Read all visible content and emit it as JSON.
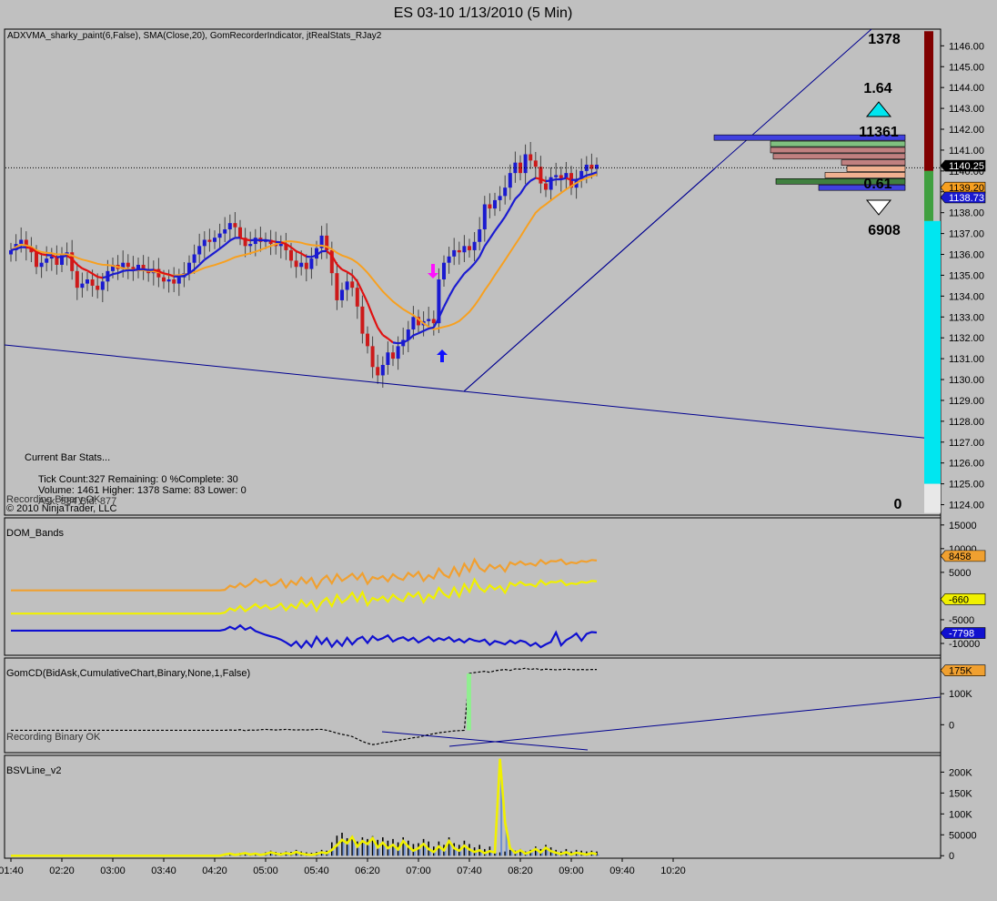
{
  "window": {
    "title": "ES 03-10  1/13/2010 (5 Min)"
  },
  "colors": {
    "background": "#c0c0c0",
    "up_bar": "#1a1ad0",
    "down_bar": "#cc1a1a",
    "neutral_bar": "#6f6f6f",
    "adxvma": "#e01010",
    "sma": "#f7a020",
    "dom_upper": "#f0a030",
    "dom_mid": "#f0f000",
    "dom_lower": "#1010d0",
    "cumdelta": "#000000",
    "bsv_line": "#f0f000",
    "bsv_hist": "#000000",
    "trendline": "#000090",
    "cyan_bar": "#00e6f0",
    "maroon_bar": "#800000",
    "green_bar": "#40a040"
  },
  "chart_data": [
    {
      "type": "candlestick",
      "panel": "price",
      "label": "ADXVMA_sharky_paint(6,False), SMA(Close,20), GomRecorderIndicator, jtRealStats_RJay2",
      "yticks": [
        1146,
        1145,
        1144,
        1143,
        1142,
        1141,
        1140,
        1139,
        1138,
        1137,
        1136,
        1135,
        1134,
        1133,
        1132,
        1131,
        1130,
        1129,
        1128,
        1127,
        1126,
        1125,
        1124
      ],
      "ytick_labels": [
        "1146.00",
        "1145.00",
        "1144.00",
        "1143.00",
        "1142.00",
        "1141.00",
        "1140.00",
        "1139.00",
        "1138.00",
        "1137.00",
        "1136.00",
        "1135.00",
        "1134.00",
        "1133.00",
        "1132.00",
        "1131.00",
        "1130.00",
        "1129.00",
        "1128.00",
        "1127.00",
        "1126.00",
        "1125.00",
        "1124.00"
      ],
      "ylim": [
        1123.5,
        1146.8
      ],
      "xtick_labels": [
        "01:40",
        "02:20",
        "03:00",
        "03:40",
        "04:20",
        "05:00",
        "05:40",
        "06:20",
        "07:00",
        "07:40",
        "08:20",
        "09:00",
        "09:40",
        "10:20"
      ],
      "closes": [
        1136.2,
        1136.5,
        1136.7,
        1136.3,
        1136.1,
        1135.4,
        1135.6,
        1135.8,
        1135.9,
        1135.5,
        1136.0,
        1136.1,
        1135.2,
        1134.4,
        1134.6,
        1134.8,
        1134.5,
        1134.3,
        1134.7,
        1135.2,
        1135.5,
        1135.3,
        1135.6,
        1135.4,
        1135.2,
        1135.5,
        1135.3,
        1135.1,
        1135.3,
        1134.9,
        1134.7,
        1134.8,
        1134.6,
        1134.9,
        1135.1,
        1135.6,
        1136.0,
        1136.4,
        1136.7,
        1136.6,
        1136.8,
        1137.0,
        1137.2,
        1137.5,
        1137.3,
        1136.8,
        1136.4,
        1136.5,
        1136.8,
        1136.6,
        1136.7,
        1136.5,
        1136.4,
        1136.5,
        1136.2,
        1135.7,
        1135.4,
        1135.6,
        1135.3,
        1135.8,
        1136.3,
        1136.9,
        1136.2,
        1135.1,
        1133.8,
        1134.3,
        1134.7,
        1134.4,
        1133.5,
        1132.2,
        1131.6,
        1130.6,
        1130.2,
        1130.7,
        1131.3,
        1131.0,
        1131.6,
        1131.9,
        1132.4,
        1133.0,
        1132.6,
        1132.8,
        1132.9,
        1132.7,
        1134.8,
        1135.6,
        1135.9,
        1136.2,
        1136.1,
        1136.4,
        1136.2,
        1136.6,
        1137.2,
        1138.4,
        1138.2,
        1138.6,
        1138.8,
        1139.2,
        1139.9,
        1140.4,
        1139.9,
        1140.8,
        1140.5,
        1140.2,
        1139.4,
        1139.1,
        1139.7,
        1139.8,
        1139.6,
        1139.9,
        1139.2,
        1139.6,
        1140.0,
        1140.3,
        1140.1,
        1140.3
      ],
      "adxvma_last": 1138.73,
      "sma_last": 1139.2,
      "last_price_label": "1140.25",
      "sma_label": "1139.20",
      "adxvma_label": "1138.73",
      "bar_colors": "up/down/neutral",
      "volume_profile": [
        {
          "price": 1141.6,
          "width": 210,
          "color": "#4040e0"
        },
        {
          "price": 1141.3,
          "width": 148,
          "color": "#80c080"
        },
        {
          "price": 1141.0,
          "width": 148,
          "color": "#c08080"
        },
        {
          "price": 1140.7,
          "width": 145,
          "color": "#c08080"
        },
        {
          "price": 1140.4,
          "width": 70,
          "color": "#c08080"
        },
        {
          "price": 1140.1,
          "width": 64,
          "color": "#f0b090"
        },
        {
          "price": 1139.8,
          "width": 88,
          "color": "#f0b090"
        },
        {
          "price": 1139.5,
          "width": 142,
          "color": "#408040"
        },
        {
          "price": 1139.2,
          "width": 95,
          "color": "#4040e0"
        }
      ],
      "stats": {
        "top": "1378",
        "ratio_up": "1.64",
        "ask_volume": "11361",
        "ratio_down": "0.61",
        "bid_volume": "6908",
        "bottom": "0"
      },
      "annotations": {
        "current_bar_title": "Current Bar Stats...",
        "line1": "Tick Count:327  Remaining: 0  %Complete: 30",
        "line2": "Volume: 1461   Higher: 1378   Same: 83   Lower: 0",
        "line3": "Ask: 584  Bid: 877",
        "recording": "Recording Binary OK",
        "copyright": "© 2010 NinjaTrader, LLC"
      }
    },
    {
      "type": "line",
      "panel": "dom",
      "label": "DOM_Bands",
      "yticks": [
        15000,
        10000,
        5000,
        -5000,
        -10000
      ],
      "ytick_labels": [
        "15000",
        "10000",
        "5000",
        "-5000",
        "-10000"
      ],
      "ylim": [
        -12500,
        16500
      ],
      "series": [
        {
          "values": [
            1200,
            1200,
            1200,
            1200,
            1200,
            1200,
            1200,
            1200,
            1200,
            1200,
            1200,
            1200,
            1200,
            1200,
            1200,
            1200,
            1200,
            1200,
            1200,
            1200,
            1200,
            1200,
            1200,
            1200,
            1200,
            1200,
            1200,
            1200,
            1200,
            1200,
            1200,
            1200,
            1200,
            1200,
            1200,
            1200,
            1200,
            1200,
            1200,
            1200,
            1200,
            1200,
            1300,
            2200,
            1800,
            2700,
            1900,
            2600,
            3600,
            2800,
            3300,
            2200,
            2600,
            3500,
            1800,
            3200,
            2400,
            3900,
            2700,
            3800,
            1700,
            3400,
            4300,
            2700,
            4600,
            3200,
            3900,
            4700,
            3500,
            4800,
            2600,
            4000,
            3600,
            4200,
            3100,
            4600,
            3800,
            3400,
            4900,
            4100,
            5100,
            3200,
            4400,
            3700,
            5800,
            4500,
            3900,
            6100,
            4300,
            6800,
            5200,
            7700,
            5900,
            5200,
            6600,
            5800,
            6500,
            5200,
            7100,
            6600,
            7300,
            6600,
            6900,
            6400,
            7600,
            6800,
            7400,
            7300,
            7700,
            6700,
            7100,
            6900,
            7400,
            7200,
            7600,
            7500
          ]
        },
        {
          "values": [
            -3700,
            -3700,
            -3700,
            -3700,
            -3700,
            -3700,
            -3700,
            -3700,
            -3700,
            -3700,
            -3700,
            -3700,
            -3700,
            -3700,
            -3700,
            -3700,
            -3700,
            -3700,
            -3700,
            -3700,
            -3700,
            -3700,
            -3700,
            -3700,
            -3700,
            -3700,
            -3700,
            -3700,
            -3700,
            -3700,
            -3700,
            -3700,
            -3700,
            -3700,
            -3700,
            -3700,
            -3700,
            -3700,
            -3700,
            -3700,
            -3700,
            -3700,
            -3500,
            -2600,
            -3100,
            -2100,
            -3200,
            -2500,
            -1700,
            -2600,
            -1900,
            -2800,
            -2400,
            -1600,
            -3000,
            -1800,
            -2600,
            -900,
            -2200,
            -1100,
            -3100,
            -1300,
            -400,
            -2100,
            200,
            -1400,
            -600,
            700,
            -1100,
            800,
            -1900,
            -400,
            -900,
            -100,
            -1200,
            300,
            -600,
            -1100,
            600,
            -200,
            800,
            -1300,
            300,
            -500,
            1700,
            400,
            -300,
            1800,
            -100,
            2500,
            900,
            3500,
            1700,
            900,
            2300,
            1400,
            2100,
            700,
            2800,
            2200,
            3000,
            2300,
            2500,
            2000,
            3300,
            2400,
            3000,
            2900,
            3300,
            2300,
            2700,
            2500,
            3000,
            2800,
            3200,
            3100
          ]
        },
        {
          "values": [
            -7300,
            -7300,
            -7300,
            -7300,
            -7300,
            -7300,
            -7300,
            -7300,
            -7300,
            -7300,
            -7300,
            -7300,
            -7300,
            -7300,
            -7300,
            -7300,
            -7300,
            -7300,
            -7300,
            -7300,
            -7300,
            -7300,
            -7300,
            -7300,
            -7300,
            -7300,
            -7300,
            -7300,
            -7300,
            -7300,
            -7300,
            -7300,
            -7300,
            -7300,
            -7300,
            -7300,
            -7300,
            -7300,
            -7300,
            -7300,
            -7300,
            -7300,
            -7100,
            -6500,
            -7000,
            -6200,
            -7100,
            -6600,
            -7400,
            -7800,
            -8200,
            -8500,
            -8800,
            -9200,
            -9800,
            -10500,
            -9600,
            -10900,
            -9500,
            -10700,
            -8600,
            -10100,
            -8900,
            -10700,
            -9400,
            -10500,
            -8800,
            -10200,
            -9100,
            -8600,
            -9900,
            -8500,
            -9300,
            -8900,
            -8300,
            -9600,
            -9000,
            -8700,
            -9400,
            -8800,
            -9800,
            -9200,
            -8600,
            -9500,
            -8900,
            -9300,
            -8700,
            -9600,
            -9100,
            -9800,
            -9000,
            -9400,
            -9600,
            -9200,
            -10300,
            -9500,
            -9800,
            -10200,
            -9400,
            -10000,
            -9400,
            -9700,
            -10500,
            -9900,
            -10800,
            -10200,
            -9700,
            -7700,
            -10400,
            -9300,
            -8700,
            -7900,
            -9400,
            -8000,
            -7600,
            -7700
          ]
        }
      ],
      "value_labels": [
        "8458",
        "-660",
        "-7798"
      ]
    },
    {
      "type": "line",
      "panel": "cumdelta",
      "label": "GomCD(BidAsk,CumulativeChart,Binary,None,1,False)",
      "yticks": [
        100000,
        0
      ],
      "ytick_labels": [
        "100K",
        "0"
      ],
      "ylim": [
        -90000,
        215000
      ],
      "value_label": "175K",
      "values": [
        -18000,
        -18000,
        -18000,
        -18000,
        -18000,
        -18000,
        -18000,
        -18000,
        -18000,
        -18000,
        -18000,
        -18000,
        -18000,
        -18000,
        -18000,
        -18000,
        -18000,
        -18000,
        -18000,
        -18000,
        -18000,
        -18000,
        -18000,
        -18000,
        -18000,
        -18000,
        -18000,
        -18000,
        -18000,
        -18000,
        -18000,
        -18000,
        -18000,
        -18000,
        -18000,
        -18000,
        -18000,
        -18000,
        -18000,
        -18000,
        -18000,
        -18000,
        -18000,
        -17000,
        -18000,
        -16000,
        -19000,
        -17000,
        -18000,
        -16000,
        -15000,
        -16000,
        -17000,
        -16000,
        -15000,
        -16000,
        -17000,
        -16000,
        -17000,
        -16000,
        -15000,
        -15000,
        -18000,
        -22000,
        -27000,
        -31000,
        -34000,
        -38000,
        -46000,
        -54000,
        -60000,
        -64000,
        -62000,
        -58000,
        -56000,
        -53000,
        -50000,
        -48000,
        -45000,
        -42000,
        -40000,
        -36000,
        -32000,
        -29000,
        -26000,
        -24000,
        -22000,
        -20000,
        -19000,
        -18000,
        165000,
        168000,
        170000,
        172000,
        169000,
        174000,
        176000,
        178000,
        175000,
        180000,
        179000,
        182000,
        178000,
        181000,
        177000,
        179000,
        178000,
        177000,
        178000,
        179000,
        178000,
        177000,
        178000,
        177000,
        178000,
        178000
      ]
    },
    {
      "type": "line",
      "panel": "bsv",
      "label": "BSVLine_v2",
      "yticks": [
        200000,
        150000,
        100000,
        50000,
        0
      ],
      "ytick_labels": [
        "200K",
        "150K",
        "100K",
        "50000",
        "0"
      ],
      "ylim": [
        -6000,
        240000
      ],
      "values": [
        0,
        0,
        0,
        0,
        0,
        0,
        0,
        0,
        0,
        0,
        0,
        0,
        0,
        0,
        0,
        0,
        0,
        0,
        0,
        0,
        0,
        0,
        0,
        0,
        0,
        0,
        0,
        0,
        0,
        0,
        0,
        0,
        0,
        0,
        0,
        0,
        0,
        0,
        0,
        0,
        0,
        0,
        3000,
        5000,
        2000,
        4000,
        6000,
        3000,
        5000,
        2000,
        4000,
        8000,
        5000,
        3000,
        6000,
        4000,
        9000,
        5000,
        3000,
        2000,
        4000,
        8000,
        6000,
        14000,
        25000,
        38000,
        30000,
        45000,
        22000,
        35000,
        28000,
        42000,
        20000,
        31000,
        18000,
        26000,
        15000,
        35000,
        22000,
        12000,
        18000,
        28000,
        16000,
        9000,
        22000,
        13000,
        35000,
        18000,
        12000,
        24000,
        15000,
        9000,
        13000,
        6000,
        11000,
        8000,
        232000,
        80000,
        18000,
        7000,
        13000,
        5000,
        9000,
        16000,
        8000,
        19000,
        11000,
        7000,
        4000,
        8000,
        3000,
        7000,
        5000,
        3000,
        6000,
        4000
      ],
      "hist": [
        0,
        0,
        0,
        0,
        0,
        0,
        0,
        0,
        0,
        0,
        0,
        0,
        0,
        0,
        0,
        0,
        0,
        0,
        0,
        0,
        0,
        0,
        0,
        0,
        0,
        0,
        0,
        0,
        0,
        0,
        0,
        0,
        0,
        0,
        0,
        0,
        0,
        0,
        0,
        0,
        0,
        0,
        4000,
        6000,
        5000,
        7000,
        8000,
        6000,
        7000,
        5000,
        8000,
        12000,
        9000,
        7000,
        10000,
        9000,
        14000,
        10000,
        8000,
        7000,
        9000,
        14000,
        12000,
        32000,
        48000,
        55000,
        42000,
        48000,
        34000,
        44000,
        40000,
        47000,
        38000,
        44000,
        36000,
        40000,
        32000,
        44000,
        36000,
        28000,
        30000,
        40000,
        34000,
        22000,
        34000,
        26000,
        44000,
        30000,
        26000,
        36000,
        28000,
        20000,
        26000,
        16000,
        22000,
        16000,
        8000,
        10000,
        14000,
        12000,
        16000,
        10000,
        14000,
        22000,
        16000,
        26000,
        20000,
        14000,
        10000,
        16000,
        10000,
        14000,
        12000,
        10000,
        12000,
        10000
      ]
    }
  ]
}
